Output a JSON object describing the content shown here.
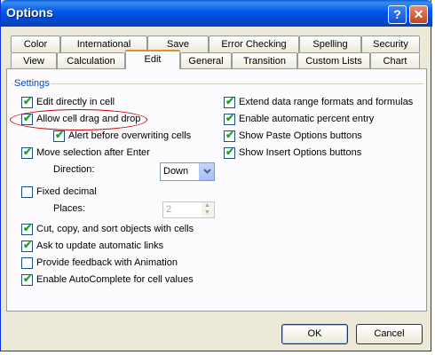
{
  "window": {
    "title": "Options"
  },
  "titlebar_buttons": {
    "help": "?",
    "close": "✕"
  },
  "tabs_row1": [
    "Color",
    "International",
    "Save",
    "Error Checking",
    "Spelling",
    "Security"
  ],
  "tabs_row2": [
    "View",
    "Calculation",
    "Edit",
    "General",
    "Transition",
    "Custom Lists",
    "Chart"
  ],
  "active_tab": "Edit",
  "settings": {
    "group_label": "Settings",
    "left": {
      "edit_directly": {
        "label": "Edit directly in cell",
        "checked": true
      },
      "allow_drag_drop": {
        "label": "Allow cell drag and drop",
        "checked": true
      },
      "alert_overwrite": {
        "label": "Alert before overwriting cells",
        "checked": true
      },
      "move_selection": {
        "label": "Move selection after Enter",
        "checked": true
      },
      "direction_label": "Direction:",
      "direction_value": "Down",
      "fixed_decimal": {
        "label": "Fixed decimal",
        "checked": false
      },
      "places_label": "Places:",
      "places_value": "2",
      "cut_copy_sort": {
        "label": "Cut, copy, and sort objects with cells",
        "checked": true
      },
      "ask_update_links": {
        "label": "Ask to update automatic links",
        "checked": true
      },
      "feedback_animation": {
        "label": "Provide feedback with Animation",
        "checked": false
      },
      "autocomplete": {
        "label": "Enable AutoComplete for cell values",
        "checked": true
      }
    },
    "right": {
      "extend_formats": {
        "label": "Extend data range formats and formulas",
        "checked": true
      },
      "auto_percent": {
        "label": "Enable automatic percent entry",
        "checked": true
      },
      "paste_options": {
        "label": "Show Paste Options buttons",
        "checked": true
      },
      "insert_options": {
        "label": "Show Insert Options buttons",
        "checked": true
      }
    }
  },
  "buttons": {
    "ok": "OK",
    "cancel": "Cancel"
  },
  "check_mark": "✔",
  "colors": {
    "titlebar": "#0055e5",
    "dialog_bg": "#ece9d8",
    "group_label": "#0046d5",
    "annotation": "#cc0000"
  }
}
